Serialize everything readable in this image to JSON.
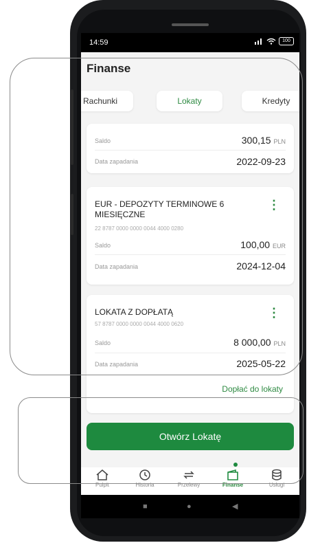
{
  "status": {
    "time": "14:59",
    "battery": "100"
  },
  "header": {
    "title": "Finanse"
  },
  "tabs": [
    {
      "label": "Rachunki"
    },
    {
      "label": "Lokaty"
    },
    {
      "label": "Kredyty"
    }
  ],
  "deposits": [
    {
      "saldo_label": "Saldo",
      "saldo_value": "300,15",
      "currency": "PLN",
      "date_label": "Data zapadania",
      "date_value": "2022-09-23"
    },
    {
      "name": "EUR - DEPOZYTY TERMINOWE 6 MIESIĘCZNE",
      "account": "22 8787 0000 0000 0044 4000 0280",
      "saldo_label": "Saldo",
      "saldo_value": "100,00",
      "currency": "EUR",
      "date_label": "Data zapadania",
      "date_value": "2024-12-04"
    },
    {
      "name": "LOKATA Z DOPŁATĄ",
      "account": "57 8787 0000 0000 0044 4000 0620",
      "saldo_label": "Saldo",
      "saldo_value": "8 000,00",
      "currency": "PLN",
      "date_label": "Data zapadania",
      "date_value": "2025-05-22"
    }
  ],
  "topup_link": "Dopłać do lokaty",
  "open_button": "Otwórz Lokatę",
  "nav": [
    {
      "label": "Pulpit",
      "icon": "home-icon"
    },
    {
      "label": "Historia",
      "icon": "history-icon"
    },
    {
      "label": "Przelewy",
      "icon": "transfer-icon"
    },
    {
      "label": "Finanse",
      "icon": "wallet-icon"
    },
    {
      "label": "Usługi",
      "icon": "database-icon"
    }
  ],
  "accent": "#1e8a3f"
}
